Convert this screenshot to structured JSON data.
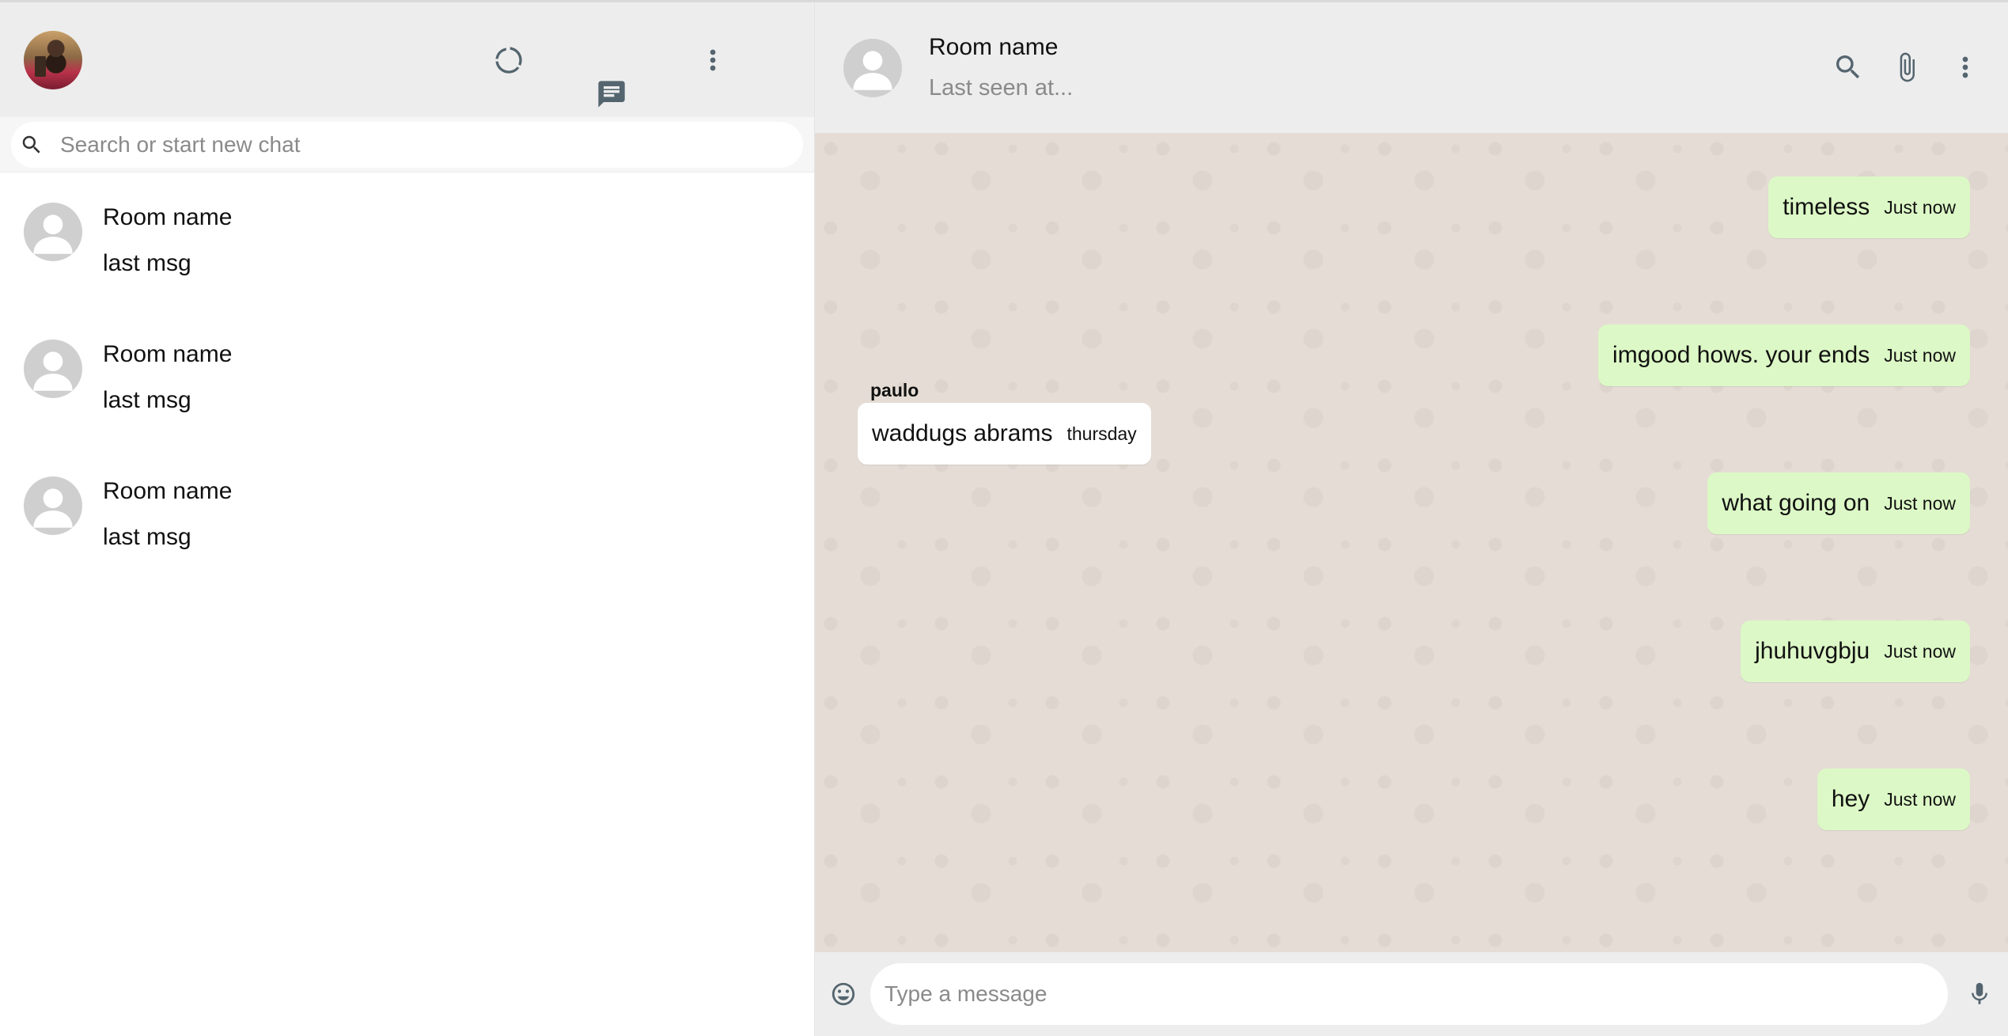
{
  "sidebar": {
    "search": {
      "placeholder": "Search or start new chat"
    },
    "rooms": [
      {
        "name": "Room name",
        "last_message": "last msg"
      },
      {
        "name": "Room name",
        "last_message": "last msg"
      },
      {
        "name": "Room name",
        "last_message": "last msg"
      }
    ]
  },
  "chat": {
    "header": {
      "room_name": "Room name",
      "last_seen": "Last seen at..."
    },
    "messages": [
      {
        "text": "timeless",
        "time": "Just now",
        "direction": "sent"
      },
      {
        "text": "imgood hows. your ends",
        "time": "Just now",
        "direction": "sent"
      },
      {
        "sender": "paulo",
        "text": "waddugs abrams",
        "time": "thursday",
        "direction": "received"
      },
      {
        "text": "what going on",
        "time": "Just now",
        "direction": "sent"
      },
      {
        "text": "jhuhuvgbju",
        "time": "Just now",
        "direction": "sent"
      },
      {
        "text": "hey",
        "time": "Just now",
        "direction": "sent"
      }
    ],
    "footer": {
      "placeholder": "Type a message"
    }
  },
  "colors": {
    "header_bg": "#ededed",
    "sent_bubble": "#dcf8c6",
    "received_bubble": "#ffffff",
    "chat_bg": "#e5ddd5",
    "icon_color": "#54656f"
  },
  "icons": {
    "sidebar_header": [
      "status-icon",
      "chat-icon",
      "more-vert-icon"
    ],
    "chat_header": [
      "search-icon",
      "attach-icon",
      "more-vert-icon"
    ],
    "footer": [
      "emoji-icon",
      "mic-icon"
    ]
  }
}
